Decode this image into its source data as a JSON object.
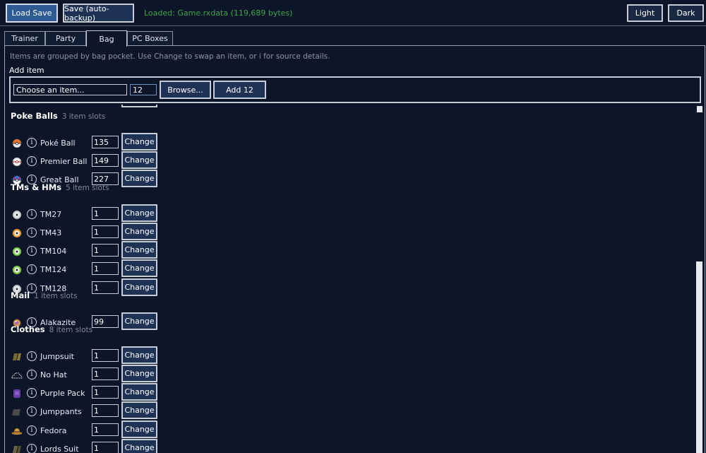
{
  "toolbar": {
    "load_label": "Load Save",
    "save_label": "Save (auto-backup)",
    "status": "Loaded: Game.rxdata  (119,689 bytes)",
    "light_label": "Light",
    "dark_label": "Dark"
  },
  "tabs": [
    {
      "label": "Trainer",
      "active": false
    },
    {
      "label": "Party",
      "active": false
    },
    {
      "label": "Bag",
      "active": true
    },
    {
      "label": "PC Boxes",
      "active": false
    }
  ],
  "bag": {
    "hint": "Items are grouped by bag pocket. Use Change to swap an item, or i for source details.",
    "add_item_label": "Add item",
    "chooser_placeholder": "Choose an item...",
    "add_qty": "12",
    "browse_label": "Browse...",
    "add_button_label": "Add 12",
    "change_label": "Change",
    "info_glyph": "i",
    "pockets": [
      {
        "name": "Poke Balls",
        "count": "3 item slots",
        "items": [
          {
            "name": "Poké Ball",
            "qty": "135",
            "icon": "poke-ball-icon"
          },
          {
            "name": "Premier Ball",
            "qty": "149",
            "icon": "premier-ball-icon"
          },
          {
            "name": "Great Ball",
            "qty": "227",
            "icon": "great-ball-icon"
          }
        ]
      },
      {
        "name": "TMs & HMs",
        "count": "5 item slots",
        "items": [
          {
            "name": "TM27",
            "qty": "1",
            "icon": "tm-disc-icon",
            "color": "#c8cdd6"
          },
          {
            "name": "TM43",
            "qty": "1",
            "icon": "tm-disc-icon",
            "color": "#f0a030"
          },
          {
            "name": "TM104",
            "qty": "1",
            "icon": "tm-disc-icon",
            "color": "#7fd04c"
          },
          {
            "name": "TM124",
            "qty": "1",
            "icon": "tm-disc-icon",
            "color": "#7fd04c"
          },
          {
            "name": "TM128",
            "qty": "1",
            "icon": "tm-disc-icon",
            "color": "#c8cdd6"
          }
        ]
      },
      {
        "name": "Mail",
        "count": "1 item slots",
        "items": [
          {
            "name": "Alakazite",
            "qty": "99",
            "icon": "mega-stone-icon"
          }
        ]
      },
      {
        "name": "Clothes",
        "count": "8 item slots",
        "items": [
          {
            "name": "Jumpsuit",
            "qty": "1",
            "icon": "jumpsuit-icon"
          },
          {
            "name": "No Hat",
            "qty": "1",
            "icon": "no-hat-icon"
          },
          {
            "name": "Purple Pack",
            "qty": "1",
            "icon": "purple-pack-icon"
          },
          {
            "name": "Jumppants",
            "qty": "1",
            "icon": "jumppants-icon"
          },
          {
            "name": "Fedora",
            "qty": "1",
            "icon": "fedora-icon"
          },
          {
            "name": "Lords Suit",
            "qty": "1",
            "icon": "suit-icon"
          }
        ]
      }
    ]
  },
  "colors": {
    "background": "#0d1629",
    "button": "#1e3256",
    "primary_button": "#2e5b94",
    "status_green": "#3ea34a"
  }
}
